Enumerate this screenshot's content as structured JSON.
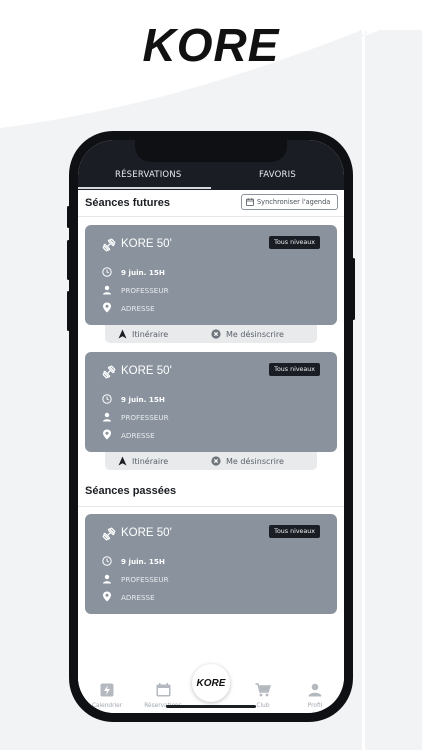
{
  "brand": "KORE",
  "tabs": [
    {
      "label": "RÉSERVATIONS",
      "active": true
    },
    {
      "label": "FAVORIS",
      "active": false
    }
  ],
  "sections": {
    "future_title": "Séances futures",
    "past_title": "Séances passées",
    "sync_label": "Synchroniser l'agenda"
  },
  "sessions_future": [
    {
      "title": "KORE 50'",
      "level": "Tous niveaux",
      "datetime": "9 juin. 15H",
      "teacher": "PROFESSEUR",
      "address": "ADRESSE",
      "action_route": "Itinéraire",
      "action_cancel": "Me désinscrire"
    },
    {
      "title": "KORE 50'",
      "level": "Tous niveaux",
      "datetime": "9 juin. 15H",
      "teacher": "PROFESSEUR",
      "address": "ADRESSE",
      "action_route": "Itinéraire",
      "action_cancel": "Me désinscrire"
    }
  ],
  "sessions_past": [
    {
      "title": "KORE 50'",
      "level": "Tous niveaux",
      "datetime": "9 juin. 15H",
      "teacher": "PROFESSEUR",
      "address": "ADRESSE"
    }
  ],
  "bottom_nav": {
    "items": [
      {
        "label": "Calendrier",
        "icon": "lightning-icon"
      },
      {
        "label": "Réservations",
        "icon": "calendar-icon"
      },
      {
        "label": "Club",
        "icon": "cart-icon"
      },
      {
        "label": "Profil",
        "icon": "user-icon"
      }
    ],
    "center_logo": "KORE"
  },
  "colors": {
    "topbar": "#1a1d23",
    "card": "#8a939d",
    "badge": "#1a1d23",
    "actions_bg": "#e8eaec"
  }
}
